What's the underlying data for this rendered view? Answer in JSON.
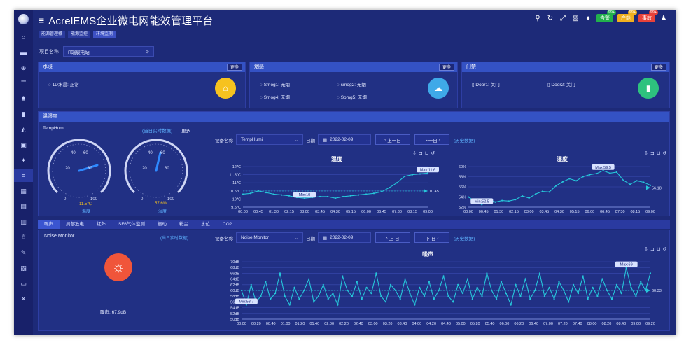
{
  "app": {
    "title": "AcrelEMS企业微电网能效管理平台"
  },
  "topbar": {
    "badges": [
      {
        "label": "告警",
        "count": "99+",
        "color": "#22b14c"
      },
      {
        "label": "产能",
        "count": "99+",
        "color": "#f2b01e"
      },
      {
        "label": "事故",
        "count": "99+",
        "color": "#e8423a"
      }
    ]
  },
  "breadcrumbs": [
    "能源管理概",
    "能源监控",
    "环境监测"
  ],
  "project": {
    "label": "项目名称",
    "value": "Π瑞宸电站"
  },
  "water": {
    "title": "水浸",
    "more": "更多",
    "items": [
      {
        "name": "1D水浸",
        "status": "正常"
      }
    ]
  },
  "smoke": {
    "title": "烟感",
    "more": "更多",
    "items": [
      {
        "name": "Smog1",
        "status": "无烟"
      },
      {
        "name": "smog2",
        "status": "无烟"
      },
      {
        "name": "Smog4",
        "status": "无烟"
      },
      {
        "name": "Somg5",
        "status": "无烟"
      }
    ]
  },
  "door": {
    "title": "门禁",
    "more": "更多",
    "items": [
      {
        "name": "Door1",
        "status": "关门"
      },
      {
        "name": "Door2",
        "status": "关门"
      }
    ]
  },
  "temphumi": {
    "section_title": "温湿度",
    "device_name": "TempHumi",
    "realtime_link": "(当日实时数据)",
    "more": "更多",
    "gauge1": {
      "value": 11.5,
      "display": "11.5℃",
      "label": "温度",
      "min": 0,
      "max": 100
    },
    "gauge2": {
      "value": 57.6,
      "display": "57.6%",
      "label": "湿度",
      "min": 0,
      "max": 100
    },
    "device_label": "设备名称",
    "device_value": "TempHumi",
    "date_label": "日期",
    "date_value": "2022-02-09",
    "prev_btn": "上一日",
    "next_btn": "下一日",
    "history_link": "(历史数据)"
  },
  "tabs": [
    "噪声",
    "局部放电",
    "红外",
    "SF6气体监测",
    "振动",
    "粉尘",
    "水位",
    "CO2"
  ],
  "noise": {
    "device_name": "Noise Monitor",
    "realtime_link": "(当日实时数据)",
    "current": {
      "label": "噪声",
      "value": "67.9dB"
    },
    "device_label": "设备名称",
    "device_value": "Noise Monitor",
    "date_label": "日期",
    "date_value": "2022-02-09",
    "prev_btn": "上 日",
    "next_btn": "下 日",
    "history_link": "(历史数据)"
  },
  "chart_data": [
    {
      "type": "line",
      "title": "温度",
      "x": [
        "00:00",
        "00:45",
        "01:30",
        "02:15",
        "03:00",
        "03:45",
        "04:30",
        "05:15",
        "06:00",
        "06:45",
        "07:30",
        "08:15",
        "09:00"
      ],
      "values": [
        10.3,
        10.35,
        10.5,
        10.4,
        10.3,
        10.25,
        10.2,
        10.1,
        10.05,
        10.1,
        10.15,
        10.15,
        10.05,
        10.15,
        10.2,
        10.25,
        10.3,
        10.35,
        10.45,
        10.7,
        11,
        11.4,
        11.5,
        11.55,
        11.6
      ],
      "ylim": [
        9.5,
        12
      ],
      "yticks": [
        "12℃",
        "11.5℃",
        "11℃",
        "10.5℃",
        "10℃",
        "9.5℃"
      ],
      "max_label": "Max:11.6",
      "min_label": "Min:10",
      "avg_label": "10.45",
      "color": "#26c6da"
    },
    {
      "type": "line",
      "title": "湿度",
      "x": [
        "00:00",
        "00:45",
        "01:30",
        "02:15",
        "03:00",
        "03:45",
        "04:30",
        "05:15",
        "06:00",
        "06:45",
        "07:30",
        "08:15",
        "09:00"
      ],
      "values": [
        54,
        53.2,
        52.5,
        53.6,
        53,
        53.3,
        53.2,
        53.5,
        54.2,
        53.8,
        54.6,
        55.1,
        55,
        56.2,
        57,
        57.6,
        57.2,
        58,
        58.4,
        58.6,
        59.2,
        58.7,
        58.9,
        57.3,
        56.5,
        57.2,
        56.9,
        56.3
      ],
      "ylim": [
        52,
        60
      ],
      "yticks": [
        "60%",
        "58%",
        "56%",
        "54%",
        "52%"
      ],
      "max_label": "Max:59.5",
      "min_label": "Min:52.5",
      "avg_label": "56.18",
      "color": "#26c6da"
    },
    {
      "type": "line",
      "title": "噪声",
      "x": [
        "00:00",
        "00:20",
        "00:40",
        "01:00",
        "01:20",
        "01:40",
        "02:00",
        "02:20",
        "02:40",
        "03:00",
        "03:20",
        "03:40",
        "04:00",
        "04:20",
        "04:40",
        "05:00",
        "05:20",
        "05:40",
        "06:00",
        "06:20",
        "06:40",
        "07:00",
        "07:20",
        "07:40",
        "08:00",
        "08:20",
        "08:40",
        "09:00",
        "09:20"
      ],
      "values": [
        60,
        55,
        62,
        56,
        58,
        63,
        57,
        59,
        66,
        58,
        55,
        61,
        57,
        60,
        64,
        56,
        58,
        62,
        57,
        59,
        55,
        65,
        60,
        58,
        63,
        57,
        61,
        59,
        66,
        58,
        56,
        62,
        60,
        57,
        64,
        59,
        55,
        61,
        58,
        63,
        57,
        60,
        65,
        58,
        56,
        62,
        59,
        64,
        57,
        61,
        58,
        66,
        60,
        57,
        63,
        59,
        55,
        62,
        58,
        64,
        57,
        60,
        66,
        58,
        61,
        57,
        63,
        60,
        56,
        62,
        59,
        65,
        57,
        61,
        58,
        64,
        60,
        57,
        62,
        59,
        67.9,
        61,
        58,
        63,
        60,
        66
      ],
      "ylim": [
        50,
        70
      ],
      "yticks": [
        "70dB",
        "68dB",
        "66dB",
        "64dB",
        "62dB",
        "60dB",
        "58dB",
        "56dB",
        "54dB",
        "52dB",
        "50dB"
      ],
      "max_label": "Max:69",
      "min_label": "Min:53.7",
      "avg_label": "60.33",
      "color": "#26c6da"
    }
  ]
}
